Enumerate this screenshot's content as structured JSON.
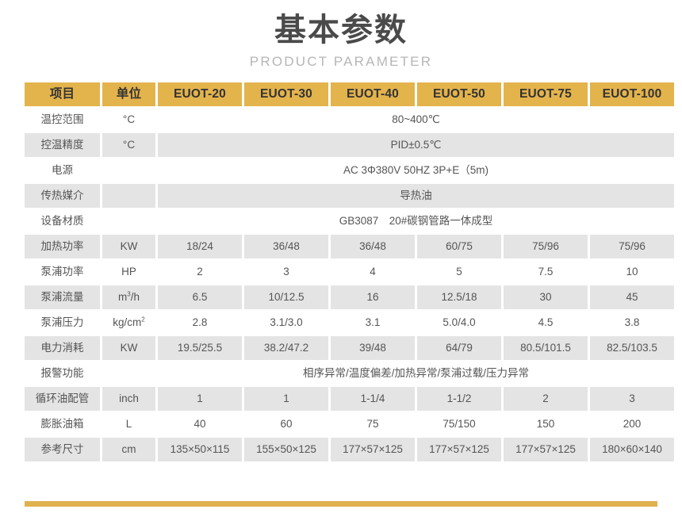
{
  "heading": {
    "main_title": "基本参数",
    "sub_title": "PRODUCT PARAMETER"
  },
  "colors": {
    "header_bg": "#e3b34c",
    "accent_bar": "#e0b14f",
    "row_shaded": "#e4e4e4",
    "row_plain": "#ffffff",
    "title_text": "#4a4a4a",
    "subtitle_text": "#b6b6b6"
  },
  "table": {
    "columns": [
      {
        "key": "item",
        "label": "项目"
      },
      {
        "key": "unit",
        "label": "单位"
      },
      {
        "key": "m20",
        "label": "EUOT-20"
      },
      {
        "key": "m30",
        "label": "EUOT-30"
      },
      {
        "key": "m40",
        "label": "EUOT-40"
      },
      {
        "key": "m50",
        "label": "EUOT-50"
      },
      {
        "key": "m75",
        "label": "EUOT-75"
      },
      {
        "key": "m100",
        "label": "EUOT-100"
      }
    ],
    "rows": [
      {
        "item": "温控范围",
        "unit": "°C",
        "merged": true,
        "merged_from_unit": false,
        "merged_value": "80~400℃",
        "shaded": false
      },
      {
        "item": "控温精度",
        "unit": "°C",
        "merged": true,
        "merged_from_unit": false,
        "merged_value": "PID±0.5℃",
        "shaded": true
      },
      {
        "item": "电源",
        "unit": "",
        "merged": true,
        "merged_from_unit": false,
        "merged_value": "AC 3Φ380V 50HZ  3P+E（5m)",
        "shaded": false
      },
      {
        "item": "传热媒介",
        "unit": "",
        "merged": true,
        "merged_from_unit": false,
        "merged_value": "导热油",
        "shaded": true
      },
      {
        "item": "设备材质",
        "unit": "",
        "merged": true,
        "merged_from_unit": false,
        "merged_value": "GB3087　20#碳钢管路一体成型",
        "shaded": false
      },
      {
        "item": "加热功率",
        "unit": "KW",
        "merged": false,
        "shaded": true,
        "values": [
          "18/24",
          "36/48",
          "36/48",
          "60/75",
          "75/96",
          "75/96"
        ]
      },
      {
        "item": "泵浦功率",
        "unit": "HP",
        "merged": false,
        "shaded": false,
        "values": [
          "2",
          "3",
          "4",
          "5",
          "7.5",
          "10"
        ]
      },
      {
        "item": "泵浦流量",
        "unit": "m3/h",
        "unit_html": "m<sup>3</sup>/h",
        "merged": false,
        "shaded": true,
        "values": [
          "6.5",
          "10/12.5",
          "16",
          "12.5/18",
          "30",
          "45"
        ]
      },
      {
        "item": "泵浦压力",
        "unit": "kg/cm2",
        "unit_html": "kg/cm<sup>2</sup>",
        "merged": false,
        "shaded": false,
        "values": [
          "2.8",
          "3.1/3.0",
          "3.1",
          "5.0/4.0",
          "4.5",
          "3.8"
        ]
      },
      {
        "item": "电力消耗",
        "unit": "KW",
        "merged": false,
        "shaded": true,
        "values": [
          "19.5/25.5",
          "38.2/47.2",
          "39/48",
          "64/79",
          "80.5/101.5",
          "82.5/103.5"
        ]
      },
      {
        "item": "报警功能",
        "unit": "",
        "merged": true,
        "merged_from_unit": false,
        "merged_value": "相序异常/温度偏差/加热异常/泵浦过载/压力异常",
        "shaded": false
      },
      {
        "item": "循环油配管",
        "unit": "inch",
        "merged": false,
        "shaded": true,
        "values": [
          "1",
          "1",
          "1-1/4",
          "1-1/2",
          "2",
          "3"
        ]
      },
      {
        "item": "膨胀油箱",
        "unit": "L",
        "merged": false,
        "shaded": false,
        "values": [
          "40",
          "60",
          "75",
          "75/150",
          "150",
          "200"
        ]
      },
      {
        "item": "参考尺寸",
        "unit": "cm",
        "merged": false,
        "shaded": true,
        "values": [
          "135×50×115",
          "155×50×125",
          "177×57×125",
          "177×57×125",
          "177×57×125",
          "180×60×140"
        ]
      }
    ]
  }
}
